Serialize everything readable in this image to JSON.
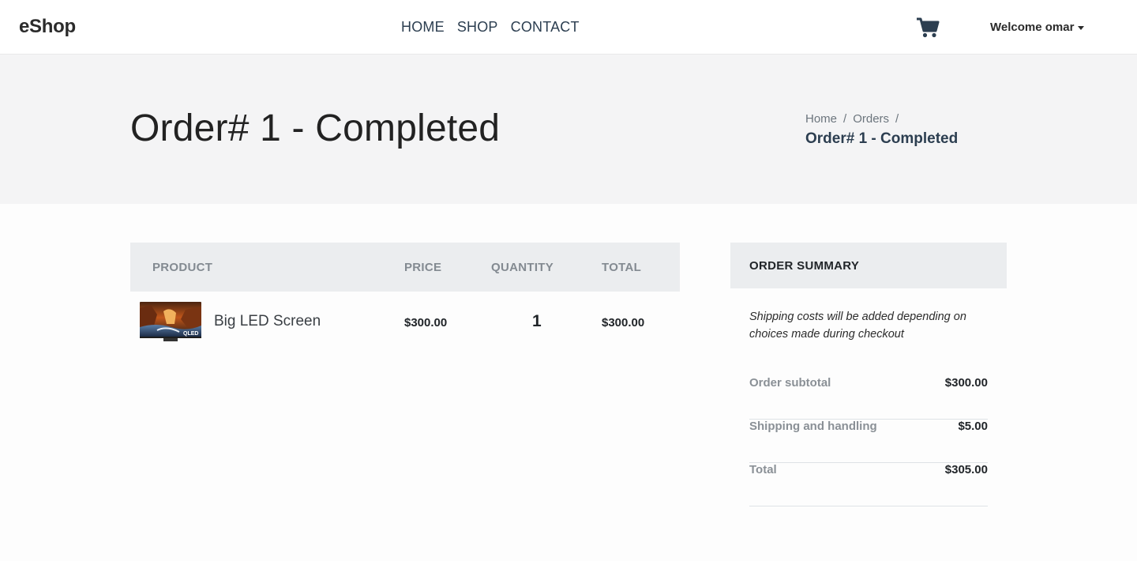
{
  "navbar": {
    "brand": "eShop",
    "links": [
      "HOME",
      "SHOP",
      "CONTACT"
    ],
    "cart_icon": "shopping-cart-icon",
    "user_menu": "Welcome omar"
  },
  "hero": {
    "title": "Order# 1 - Completed",
    "breadcrumb": {
      "items": [
        "Home",
        "Orders"
      ],
      "separator": "/",
      "active": "Order# 1 - Completed"
    }
  },
  "order_table": {
    "headers": [
      "PRODUCT",
      "PRICE",
      "QUANTITY",
      "TOTAL"
    ],
    "rows": [
      {
        "name": "Big LED Screen",
        "price": "$300.00",
        "quantity": "1",
        "total": "$300.00",
        "thumb_label": "QLED"
      }
    ]
  },
  "summary": {
    "title": "ORDER SUMMARY",
    "note": "Shipping costs will be added depending on choices made during checkout",
    "rows": [
      {
        "label": "Order subtotal",
        "value": "$300.00"
      },
      {
        "label": "Shipping and handling",
        "value": "$5.00"
      },
      {
        "label": "Total",
        "value": "$305.00"
      }
    ]
  },
  "colors": {
    "nav_text": "#2c3e50",
    "hero_bg": "#f4f4f5",
    "table_header_bg": "#ebedef",
    "muted": "#8a9096"
  }
}
